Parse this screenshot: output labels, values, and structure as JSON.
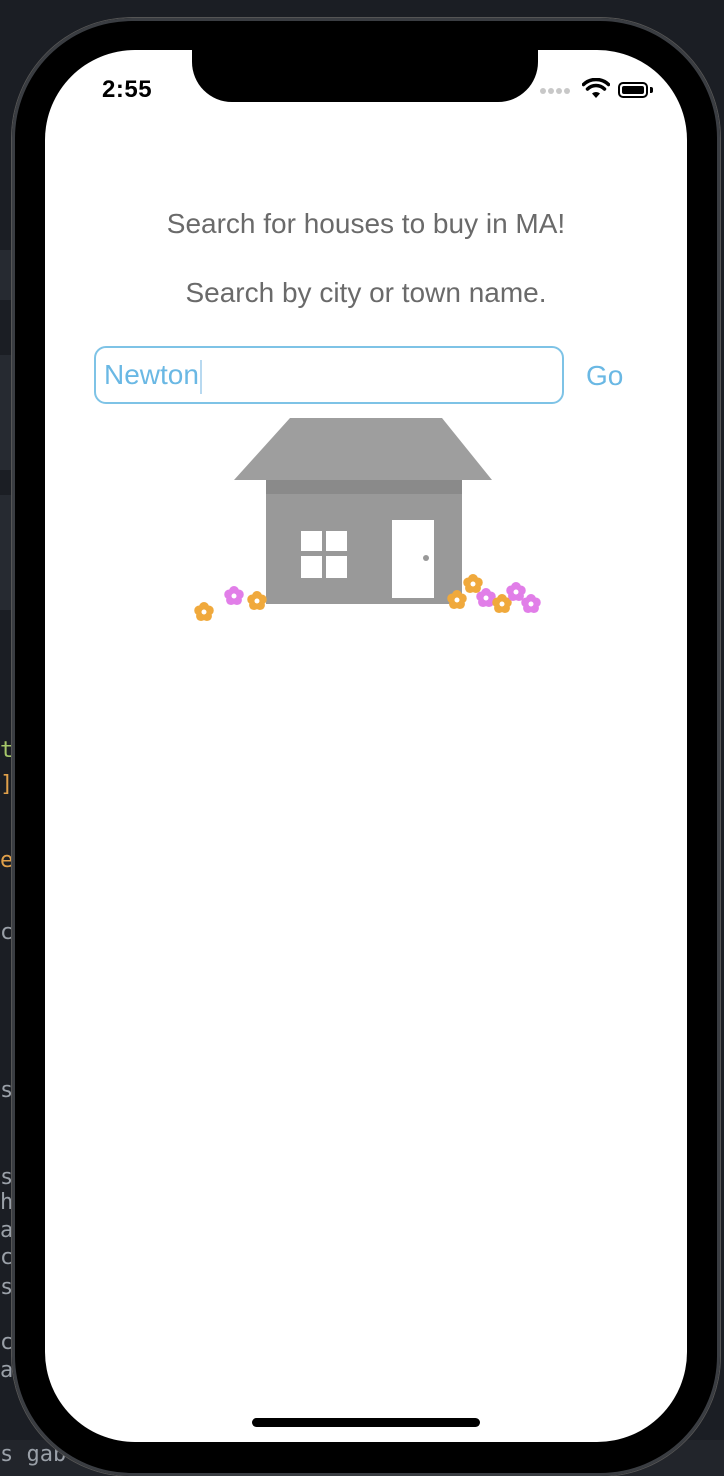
{
  "status_bar": {
    "time": "2:55"
  },
  "main": {
    "headline": "Search for houses to buy in MA!",
    "subline": "Search by city or town name.",
    "search": {
      "value": "Newton"
    },
    "go_label": "Go"
  },
  "background": {
    "bottom_text": "s gab"
  },
  "colors": {
    "accent": "#6ab8e4",
    "input_border": "#7ec3e6",
    "house_gray": "#999999",
    "roof_gray": "#9e9e9e",
    "flower_orange": "#f0a93c",
    "flower_pink": "#e17ee8"
  }
}
